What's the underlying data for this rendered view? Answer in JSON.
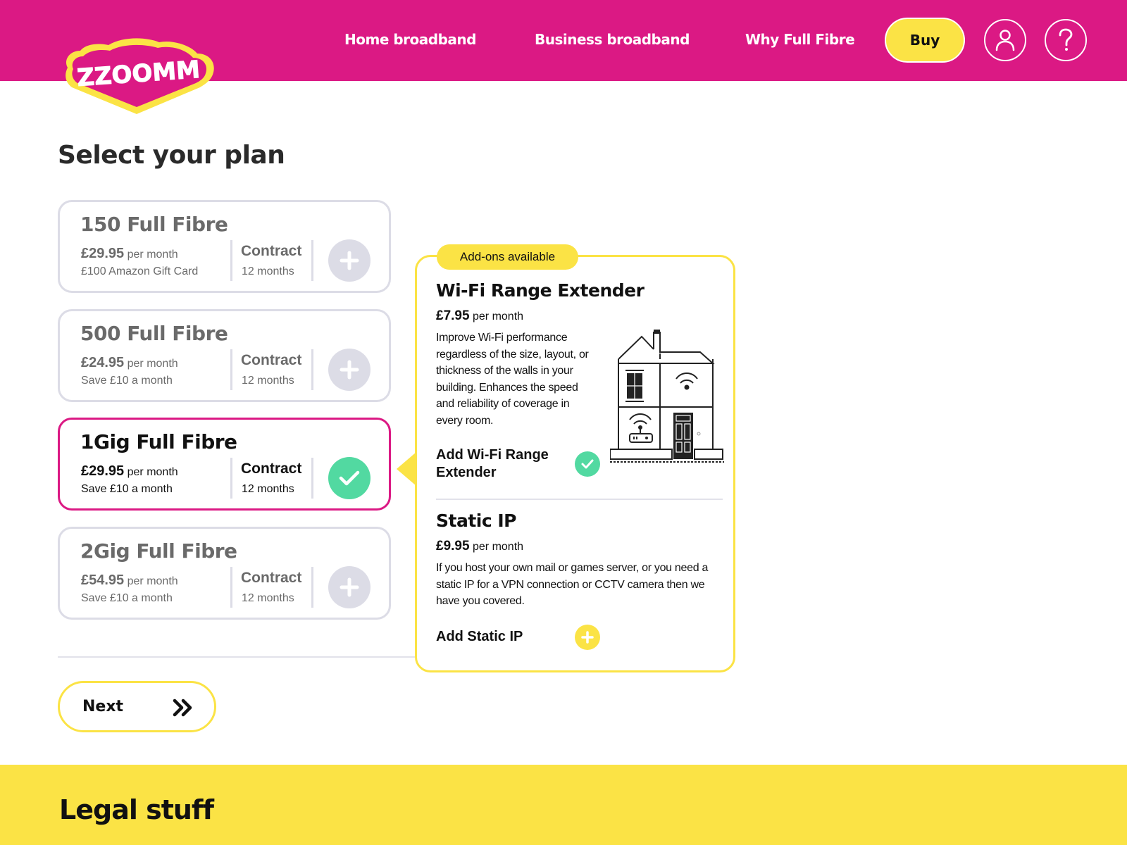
{
  "header": {
    "brand": "ZZOOMM",
    "nav": [
      "Home broadband",
      "Business broadband",
      "Why Full Fibre"
    ],
    "buy_label": "Buy",
    "account_icon": "user-icon",
    "help_icon": "help-icon"
  },
  "colors": {
    "brand_pink": "#db1984",
    "brand_yellow": "#fbe345",
    "success_green": "#52d9a1",
    "muted_grey": "#dcdce6"
  },
  "page": {
    "title": "Select your plan"
  },
  "plans": [
    {
      "name": "150 Full Fibre",
      "price": "£29.95",
      "price_unit": "per month",
      "note": "£100 Amazon Gift Card",
      "contract_label": "Contract",
      "contract_value": "12 months",
      "selected": false
    },
    {
      "name": "500 Full Fibre",
      "price": "£24.95",
      "price_unit": "per month",
      "note": "Save £10 a month",
      "contract_label": "Contract",
      "contract_value": "12 months",
      "selected": false
    },
    {
      "name": "1Gig Full Fibre",
      "price": "£29.95",
      "price_unit": "per month",
      "note": "Save £10 a month",
      "contract_label": "Contract",
      "contract_value": "12 months",
      "selected": true
    },
    {
      "name": "2Gig Full Fibre",
      "price": "£54.95",
      "price_unit": "per month",
      "note": "Save £10 a month",
      "contract_label": "Contract",
      "contract_value": "12 months",
      "selected": false
    }
  ],
  "addons": {
    "badge": "Add-ons available",
    "items": [
      {
        "title": "Wi-Fi Range Extender",
        "price": "£7.95",
        "price_unit": "per month",
        "description": "Improve Wi-Fi performance regardless of the size, layout, or thickness of the walls in your building. Enhances the speed and reliability of coverage in every room.",
        "action_label": "Add Wi-Fi Range Extender",
        "added": true
      },
      {
        "title": "Static IP",
        "price": "£9.95",
        "price_unit": "per month",
        "description": "If you host your own mail or games server, or you need a static IP for a VPN connection or CCTV camera then we have you covered.",
        "action_label": "Add Static IP",
        "added": false
      }
    ]
  },
  "next_button": {
    "label": "Next"
  },
  "footer": {
    "title": "Legal stuff"
  }
}
